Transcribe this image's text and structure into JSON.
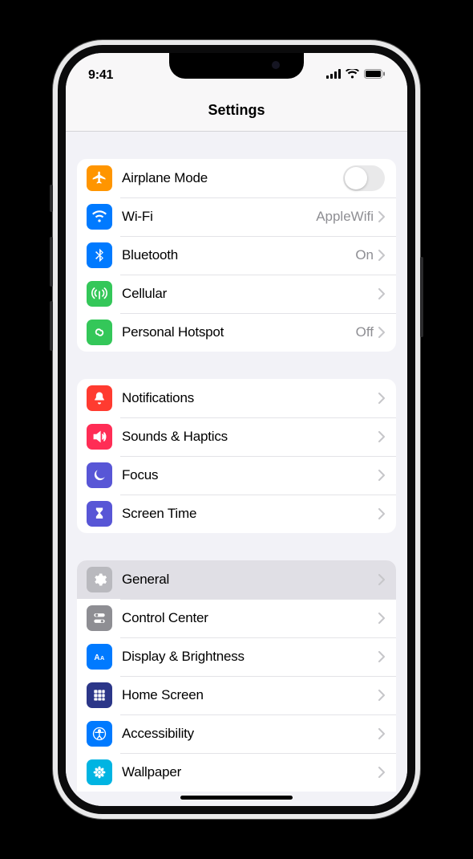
{
  "status": {
    "time": "9:41"
  },
  "header": {
    "title": "Settings"
  },
  "groups": [
    {
      "rows": [
        {
          "id": "airplane",
          "label": "Airplane Mode",
          "icon": "airplane",
          "color": "c-orange",
          "type": "toggle",
          "on": false
        },
        {
          "id": "wifi",
          "label": "Wi-Fi",
          "detail": "AppleWifi",
          "icon": "wifi",
          "color": "c-blue",
          "type": "nav"
        },
        {
          "id": "bluetooth",
          "label": "Bluetooth",
          "detail": "On",
          "icon": "bluetooth",
          "color": "c-blue",
          "type": "nav"
        },
        {
          "id": "cellular",
          "label": "Cellular",
          "icon": "antenna",
          "color": "c-green",
          "type": "nav"
        },
        {
          "id": "hotspot",
          "label": "Personal Hotspot",
          "detail": "Off",
          "icon": "link",
          "color": "c-green",
          "type": "nav"
        }
      ]
    },
    {
      "rows": [
        {
          "id": "notifications",
          "label": "Notifications",
          "icon": "bell",
          "color": "c-red",
          "type": "nav"
        },
        {
          "id": "sounds",
          "label": "Sounds & Haptics",
          "icon": "speaker",
          "color": "c-pink",
          "type": "nav"
        },
        {
          "id": "focus",
          "label": "Focus",
          "icon": "moon",
          "color": "c-indigo",
          "type": "nav"
        },
        {
          "id": "screentime",
          "label": "Screen Time",
          "icon": "hourglass",
          "color": "c-indigo",
          "type": "nav"
        }
      ]
    },
    {
      "rows": [
        {
          "id": "general",
          "label": "General",
          "icon": "gear",
          "color": "c-lightgray",
          "type": "nav",
          "selected": true
        },
        {
          "id": "controlcenter",
          "label": "Control Center",
          "icon": "switches",
          "color": "c-gray",
          "type": "nav"
        },
        {
          "id": "display",
          "label": "Display & Brightness",
          "icon": "aa",
          "color": "c-blue",
          "type": "nav"
        },
        {
          "id": "homescreen",
          "label": "Home Screen",
          "icon": "grid",
          "color": "c-navy",
          "type": "nav"
        },
        {
          "id": "accessibility",
          "label": "Accessibility",
          "icon": "person",
          "color": "c-blue",
          "type": "nav"
        },
        {
          "id": "wallpaper",
          "label": "Wallpaper",
          "icon": "flower",
          "color": "c-cyan",
          "type": "nav"
        }
      ]
    }
  ]
}
